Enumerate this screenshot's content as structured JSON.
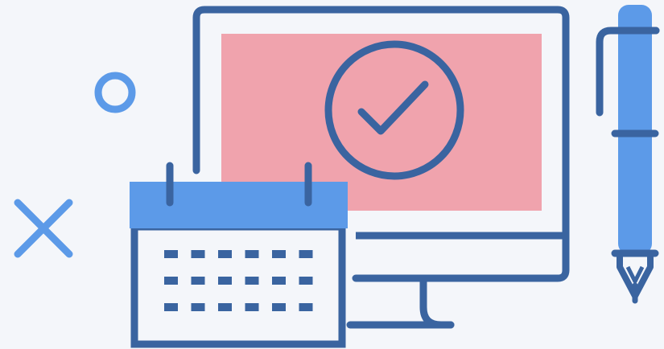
{
  "illustration": {
    "colors": {
      "background": "#f4f6fa",
      "outline": "#3a64a0",
      "accent_blue": "#5c9ae8",
      "screen_pink": "#f0a3ad",
      "white": "#ffffff"
    },
    "icons": [
      "circle-decoration-icon",
      "x-decoration-icon",
      "monitor-icon",
      "check-circle-icon",
      "calendar-icon",
      "pen-icon"
    ],
    "calendar": {
      "rows": 3,
      "columns": 6
    }
  }
}
